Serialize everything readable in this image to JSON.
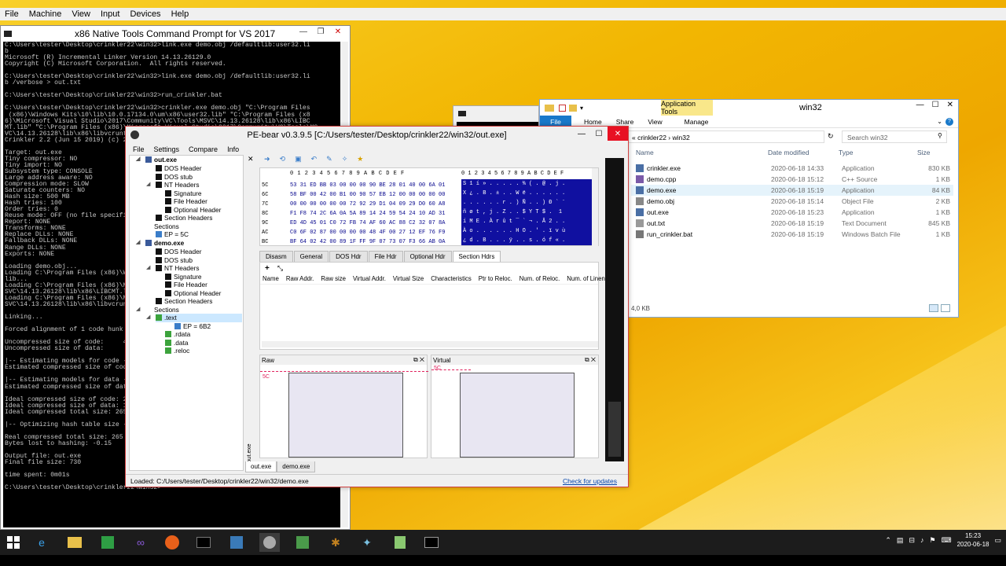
{
  "vm_menu": [
    "File",
    "Machine",
    "View",
    "Input",
    "Devices",
    "Help"
  ],
  "cmd": {
    "title": "x86 Native Tools Command Prompt for VS 2017",
    "lines": [
      "C:\\Users\\tester\\Desktop\\crinkler22\\win32>link.exe demo.obj /defaultlib:user32.li",
      "b",
      "Microsoft (R) Incremental Linker Version 14.13.26129.0",
      "Copyright (C) Microsoft Corporation.  All rights reserved.",
      "",
      "C:\\Users\\tester\\Desktop\\crinkler22\\win32>link.exe demo.obj /defaultlib:user32.li",
      "b /verbose > out.txt",
      "",
      "C:\\Users\\tester\\Desktop\\crinkler22\\win32>run_crinkler.bat",
      "",
      "C:\\Users\\tester\\Desktop\\crinkler22\\win32>crinkler.exe demo.obj \"C:\\Program Files",
      " (x86)\\Windows Kits\\10\\lib\\10.0.17134.0\\um\\x86\\user32.lib\" \"C:\\Program Files (x8",
      "6)\\Microsoft Visual Studio\\2017\\Community\\VC\\Tools\\MSVC\\14.13.26128\\lib\\x86\\LIBC",
      "MT.lib\" \"C:\\Program Files (x86)\\Microsoft Visual Studio\\2017\\Community\\VC\\Tools\\MS",
      "VC\\14.13.26128\\lib\\x86\\libvcruntime.lib\"",
      "Crinkler 2.2 (Jun 15 2019) (c) 2005-2019 Aske Simon Christensen & Rune Stubbe",
      "",
      "Target: out.exe",
      "Tiny compressor: NO",
      "Tiny import: NO",
      "Subsystem type: CONSOLE",
      "Large address aware: NO",
      "Compression mode: SLOW",
      "Saturate counters: NO",
      "Hash size: 500 MB",
      "Hash tries: 100",
      "Order tries: 0",
      "Reuse mode: OFF (no file specified)",
      "Report: NONE",
      "Transforms: NONE",
      "Replace DLLs: NONE",
      "Fallback DLLs: NONE",
      "Range DLLs: NONE",
      "Exports: NONE",
      "",
      "Loading demo.obj...",
      "Loading C:\\Program Files (x86)\\Windows Kits\\10\\lib\\10.0.17134.0\\um\\x86\\user32.",
      "lib...",
      "Loading C:\\Program Files (x86)\\Microsoft Visual Studio\\2017\\Community\\VC\\Tools\\M",
      "SVC\\14.13.26128\\lib\\x86\\LIBCMT.lib...",
      "Loading C:\\Program Files (x86)\\Microsoft Visual Studio\\2017\\Community\\VC\\Tools\\M",
      "SVC\\14.13.26128\\lib\\x86\\libvcruntime.lib...",
      "",
      "Linking...",
      "",
      "Forced alignment of 1 code hunk to 1 byte",
      "",
      "Uncompressed size of code:     436",
      "Uncompressed size of data:      18",
      "",
      "|-- Estimating models for code ----------------------------|",
      "Estimated compressed size of code: 254.88",
      "",
      "|-- Estimating models for data ----------------------------|",
      "Estimated compressed size of data: 10.79",
      "",
      "Ideal compressed size of code: 254.88",
      "Ideal compressed size of data: 10.79",
      "Ideal compressed total size: 265.67",
      "",
      "|-- Optimizing hash table size ---------------------------|",
      "",
      "Real compressed total size: 265",
      "Bytes lost to hashing: -0.15",
      "",
      "Output file: out.exe",
      "Final file size: 730",
      "",
      "time spent: 0m01s",
      "",
      "C:\\Users\\tester\\Desktop\\crinkler22\\win32>"
    ]
  },
  "explorer": {
    "app_tools": "Application Tools",
    "title": "win32",
    "ribbon": [
      "File",
      "Home",
      "Share",
      "View",
      "Manage"
    ],
    "breadcrumb": "« crinkler22  ›  win32",
    "search_placeholder": "Search win32",
    "columns": [
      "Name",
      "Date modified",
      "Type",
      "Size"
    ],
    "files": [
      {
        "name": "crinkler.exe",
        "date": "2020-06-18 14:33",
        "type": "Application",
        "size": "830 KB",
        "color": "#4a6fa5"
      },
      {
        "name": "demo.cpp",
        "date": "2020-06-18 15:12",
        "type": "C++ Source",
        "size": "1 KB",
        "color": "#7a5aa8"
      },
      {
        "name": "demo.exe",
        "date": "2020-06-18 15:19",
        "type": "Application",
        "size": "84 KB",
        "color": "#4a6fa5"
      },
      {
        "name": "demo.obj",
        "date": "2020-06-18 15:14",
        "type": "Object File",
        "size": "2 KB",
        "color": "#888888"
      },
      {
        "name": "out.exe",
        "date": "2020-06-18 15:23",
        "type": "Application",
        "size": "1 KB",
        "color": "#4a6fa5"
      },
      {
        "name": "out.txt",
        "date": "2020-06-18 15:19",
        "type": "Text Document",
        "size": "845 KB",
        "color": "#999999"
      },
      {
        "name": "run_crinkler.bat",
        "date": "2020-06-18 15:19",
        "type": "Windows Batch File",
        "size": "1 KB",
        "color": "#777777"
      }
    ],
    "status": "4,0 KB"
  },
  "pebear": {
    "title": "PE-bear v0.3.9.5 [C:/Users/tester/Desktop/crinkler22/win32/out.exe]",
    "menu": [
      "File",
      "Settings",
      "Compare",
      "Info"
    ],
    "tree": {
      "f1": "out.exe",
      "f1_dos": "DOS Header",
      "f1_stub": "DOS stub",
      "f1_nt": "NT Headers",
      "f1_sig": "Signature",
      "f1_fh": "File Header",
      "f1_oh": "Optional Header",
      "f1_sh": "Section Headers",
      "f1_sections": "Sections",
      "f1_ep": "EP = 5C",
      "f2": "demo.exe",
      "f2_dos": "DOS Header",
      "f2_stub": "DOS stub",
      "f2_nt": "NT Headers",
      "f2_sig": "Signature",
      "f2_fh": "File Header",
      "f2_oh": "Optional Header",
      "f2_sh": "Section Headers",
      "f2_sections": "Sections",
      "s_text": ".text",
      "s_ep": "EP = 6B2",
      "s_rdata": ".rdata",
      "s_data": ".data",
      "s_reloc": ".reloc"
    },
    "side_tab": "out.exe",
    "hex_header": "0 1 2 3 4 5 6 7 8 9 A B C D E F",
    "ascii_header": "0 1 2 3 4 5 6 7 8 9 A B C D E F",
    "offsets": [
      "5C",
      "6C",
      "7C",
      "8C",
      "9C",
      "AC",
      "BC"
    ],
    "hex_rows": [
      "53 31 ED BB 03 00 00 00 90 BE 28 01 40 00 6A 01",
      "58 BF 00 42 00 B1 00 90 57 EB 12 00 00 00 00 00",
      "00 00 00 00 00 00 72 92 29 D1 04 09 29 D0 60 A8",
      "F1 F8 74 2C 6A 0A 5A 89 14 24 59 54 24 10 AD 31",
      "ED 4D 45 01 C0 72 FB 74 AF 60 AC 88 C2 32 07 8A",
      "C0 6F 02 87 00 00 00 00 48 4F 00 27 12 EF 76 F9",
      "BF 64 02 42 00 89 1F FF 9F 07 73 07 F3 66 AB 0A"
    ],
    "ascii_rows": [
      "S 1 í » . . . . . ¾ ( . @ . j .",
      "X ¿ . B . ± . . W ë . . . . . .",
      ". . . . . . r . ) Ñ . . ) Ð ` ¨",
      "ñ ø t , j . Z . . $ Y T $ . ­ 1",
      "í M E . À r û t ¯ ` ¬ . Â 2 . .",
      "À o . . . . . . H O . ' . ï v ù",
      "¿ d . B . . . ÿ . . s . ó f « ."
    ],
    "tabs": [
      "Disasm",
      "General",
      "DOS Hdr",
      "File Hdr",
      "Optional Hdr",
      "Section Hdrs"
    ],
    "sec_columns": [
      "Name",
      "Raw Addr.",
      "Raw size",
      "Virtual Addr.",
      "Virtual Size",
      "Characteristics",
      "Ptr to Reloc.",
      "Num. of Reloc.",
      "Num. of Linenum."
    ],
    "raw_label": "Raw",
    "virtual_label": "Virtual",
    "raw_marker": "5C",
    "virtual_marker": "5C",
    "bottom_tabs": [
      "out.exe",
      "demo.exe"
    ],
    "status": "Loaded: C:/Users/tester/Desktop/crinkler22/win32/demo.exe",
    "update_link": "Check for updates"
  },
  "clock": {
    "time": "15:23",
    "date": "2020-06-18"
  }
}
